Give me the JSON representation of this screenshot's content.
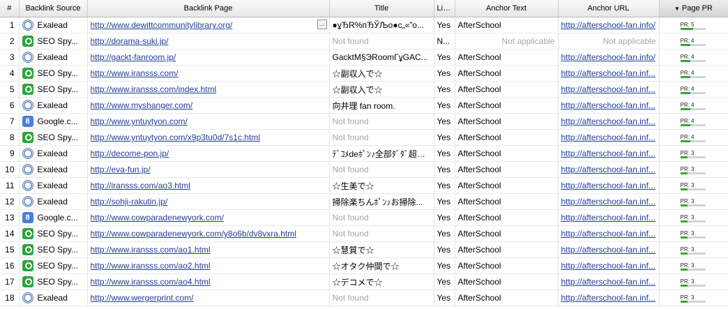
{
  "columns": [
    "#",
    "Backlink Source",
    "Backlink Page",
    "Title",
    "Lin...",
    "Anchor Text",
    "Anchor URL",
    "Page PR"
  ],
  "sort_indicator": "▼",
  "rows": [
    {
      "num": "1",
      "src_icon": "exalead-icon",
      "src": "Exalead",
      "page": "http://www.dewittcommunitylibrary.org/",
      "page_btn": "...",
      "title": "●ұЂR%пЂЎЉo●c„«”o...",
      "title_gray": false,
      "lin": "Yes",
      "anchor": "AfterSchool",
      "anchor_gray": false,
      "url": "http://afterschool-fan.info/",
      "url_gray": false,
      "pr": "PR: 5",
      "pr_value": 5
    },
    {
      "num": "2",
      "src_icon": "seo-spyglass-icon",
      "src": "SEO Spy...",
      "page": "http://dorama-suki.jp/",
      "title": "Not found",
      "title_gray": true,
      "lin": "N...",
      "anchor": "Not applicable",
      "anchor_gray": true,
      "url": "Not applicable",
      "url_gray": true,
      "pr": "PR: 4",
      "pr_value": 4
    },
    {
      "num": "3",
      "src_icon": "exalead-icon",
      "src": "Exalead",
      "page": "http://gackt-fanroom.jp/",
      "title": "GacktM§ЭRoomГұGAC...",
      "title_gray": false,
      "lin": "Yes",
      "anchor": "AfterSchool",
      "anchor_gray": false,
      "url": "http://afterschool-fan.info/",
      "url_gray": false,
      "pr": "PR: 4",
      "pr_value": 4
    },
    {
      "num": "4",
      "src_icon": "seo-spyglass-icon",
      "src": "SEO Spy...",
      "page": "http://www.iransss.com/",
      "title": "☆副収入で☆",
      "title_gray": false,
      "lin": "Yes",
      "anchor": "AfterSchool",
      "anchor_gray": false,
      "url": "http://afterschool-fan.inf...",
      "url_gray": false,
      "pr": "PR: 4",
      "pr_value": 4
    },
    {
      "num": "5",
      "src_icon": "seo-spyglass-icon",
      "src": "SEO Spy...",
      "page": "http://www.iransss.com/index.html",
      "title": "☆副収入で☆",
      "title_gray": false,
      "lin": "Yes",
      "anchor": "AfterSchool",
      "anchor_gray": false,
      "url": "http://afterschool-fan.inf...",
      "url_gray": false,
      "pr": "PR: 4",
      "pr_value": 4
    },
    {
      "num": "6",
      "src_icon": "exalead-icon",
      "src": "Exalead",
      "page": "http://www.myshanger.com/",
      "title": "向井理 fan room.",
      "title_gray": false,
      "lin": "Yes",
      "anchor": "AfterSchool",
      "anchor_gray": false,
      "url": "http://afterschool-fan.inf...",
      "url_gray": false,
      "pr": "PR: 4",
      "pr_value": 4
    },
    {
      "num": "7",
      "src_icon": "google-icon",
      "src": "Google.c...",
      "page": "http://www.yntuytyon.com/",
      "title": "Not found",
      "title_gray": true,
      "lin": "Yes",
      "anchor": "AfterSchool",
      "anchor_gray": false,
      "url": "http://afterschool-fan.inf...",
      "url_gray": false,
      "pr": "PR: 4",
      "pr_value": 4
    },
    {
      "num": "8",
      "src_icon": "seo-spyglass-icon",
      "src": "SEO Spy...",
      "page": "http://www.yntuytyon.com/x9p3tu0d/7s1c.html",
      "title": "Not found",
      "title_gray": true,
      "lin": "Yes",
      "anchor": "AfterSchool",
      "anchor_gray": false,
      "url": "http://afterschool-fan.inf...",
      "url_gray": false,
      "pr": "PR: 4",
      "pr_value": 4
    },
    {
      "num": "9",
      "src_icon": "exalead-icon",
      "src": "Exalead",
      "page": "http://decome-pon.jp/",
      "title": "ﾃﾞｺﾒdeﾎﾟﾝ♪全部ﾀﾞﾀﾞ超加...",
      "title_gray": false,
      "lin": "Yes",
      "anchor": "AfterSchool",
      "anchor_gray": false,
      "url": "http://afterschool-fan.inf...",
      "url_gray": false,
      "pr": "PR: 3",
      "pr_value": 3
    },
    {
      "num": "10",
      "src_icon": "exalead-icon",
      "src": "Exalead",
      "page": "http://eva-fun.jp/",
      "title": "Not found",
      "title_gray": true,
      "lin": "Yes",
      "anchor": "AfterSchool",
      "anchor_gray": false,
      "url": "http://afterschool-fan.inf...",
      "url_gray": false,
      "pr": "PR: 3",
      "pr_value": 3
    },
    {
      "num": "11",
      "src_icon": "exalead-icon",
      "src": "Exalead",
      "page": "http://iransss.com/ao3.html",
      "title": "☆生美で☆",
      "title_gray": false,
      "lin": "Yes",
      "anchor": "AfterSchool",
      "anchor_gray": false,
      "url": "http://afterschool-fan.inf...",
      "url_gray": false,
      "pr": "PR: 3",
      "pr_value": 3
    },
    {
      "num": "12",
      "src_icon": "exalead-icon",
      "src": "Exalead",
      "page": "http://sohji-rakutin.jp/",
      "title": "掃除楽ちんﾎﾟﾝ♪お掃除...",
      "title_gray": false,
      "lin": "Yes",
      "anchor": "AfterSchool",
      "anchor_gray": false,
      "url": "http://afterschool-fan.inf...",
      "url_gray": false,
      "pr": "PR: 3",
      "pr_value": 3
    },
    {
      "num": "13",
      "src_icon": "google-icon",
      "src": "Google.c...",
      "page": "http://www.cowparadenewyork.com/",
      "title": "Not found",
      "title_gray": true,
      "lin": "Yes",
      "anchor": "AfterSchool",
      "anchor_gray": false,
      "url": "http://afterschool-fan.inf...",
      "url_gray": false,
      "pr": "PR: 3",
      "pr_value": 3
    },
    {
      "num": "14",
      "src_icon": "seo-spyglass-icon",
      "src": "SEO Spy...",
      "page": "http://www.cowparadenewyork.com/y8o6b/dv8vxra.html",
      "title": "Not found",
      "title_gray": true,
      "lin": "Yes",
      "anchor": "AfterSchool",
      "anchor_gray": false,
      "url": "http://afterschool-fan.inf...",
      "url_gray": false,
      "pr": "PR: 3",
      "pr_value": 3
    },
    {
      "num": "15",
      "src_icon": "seo-spyglass-icon",
      "src": "SEO Spy...",
      "page": "http://www.iransss.com/ao1.html",
      "title": "☆慧質で☆",
      "title_gray": false,
      "lin": "Yes",
      "anchor": "AfterSchool",
      "anchor_gray": false,
      "url": "http://afterschool-fan.inf...",
      "url_gray": false,
      "pr": "PR: 3",
      "pr_value": 3
    },
    {
      "num": "16",
      "src_icon": "seo-spyglass-icon",
      "src": "SEO Spy...",
      "page": "http://www.iransss.com/ao2.html",
      "title": "☆オタク仲間で☆",
      "title_gray": false,
      "lin": "Yes",
      "anchor": "AfterSchool",
      "anchor_gray": false,
      "url": "http://afterschool-fan.inf...",
      "url_gray": false,
      "pr": "PR: 3",
      "pr_value": 3
    },
    {
      "num": "17",
      "src_icon": "seo-spyglass-icon",
      "src": "SEO Spy...",
      "page": "http://www.iransss.com/ao4.html",
      "title": "☆デコメで☆",
      "title_gray": false,
      "lin": "Yes",
      "anchor": "AfterSchool",
      "anchor_gray": false,
      "url": "http://afterschool-fan.inf...",
      "url_gray": false,
      "pr": "PR: 3",
      "pr_value": 3
    },
    {
      "num": "18",
      "src_icon": "exalead-icon",
      "src": "Exalead",
      "page": "http://www.wergerprint.com/",
      "title": "Not found",
      "title_gray": true,
      "lin": "Yes",
      "anchor": "AfterSchool",
      "anchor_gray": false,
      "url": "http://afterschool-fan.inf...",
      "url_gray": false,
      "pr": "PR: 3",
      "pr_value": 3
    }
  ]
}
